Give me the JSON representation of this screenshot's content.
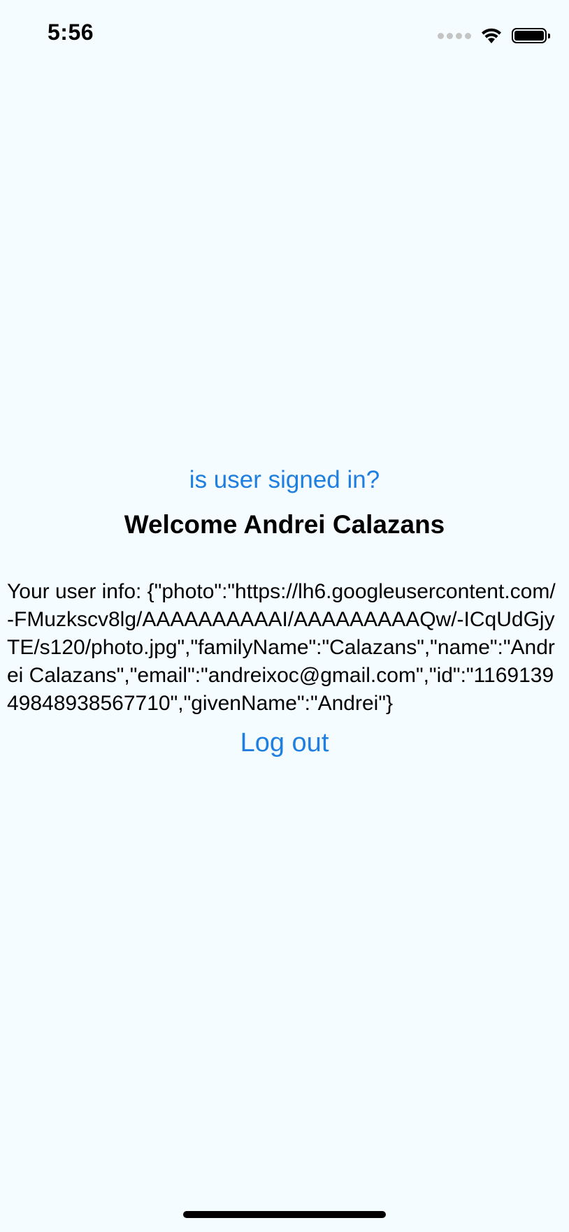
{
  "status_bar": {
    "time": "5:56",
    "icons": [
      "signal-icon",
      "wifi-icon",
      "battery-icon"
    ]
  },
  "main": {
    "signed_in_link": "is user signed in?",
    "welcome": "Welcome Andrei Calazans",
    "user_info": "Your user info: {\"photo\":\"https://lh6.googleusercontent.com/-FMuzkscv8lg/AAAAAAAAAAI/AAAAAAAAAQw/-ICqUdGjyTE/s120/photo.jpg\",\"familyName\":\"Calazans\",\"name\":\"Andrei Calazans\",\"email\":\"andreixoc@gmail.com\",\"id\":\"116913949848938567710\",\"givenName\":\"Andrei\"}",
    "logout_link": "Log out"
  },
  "colors": {
    "background": "#F5FCFF",
    "link": "#1f7fe0",
    "text": "#000000"
  }
}
